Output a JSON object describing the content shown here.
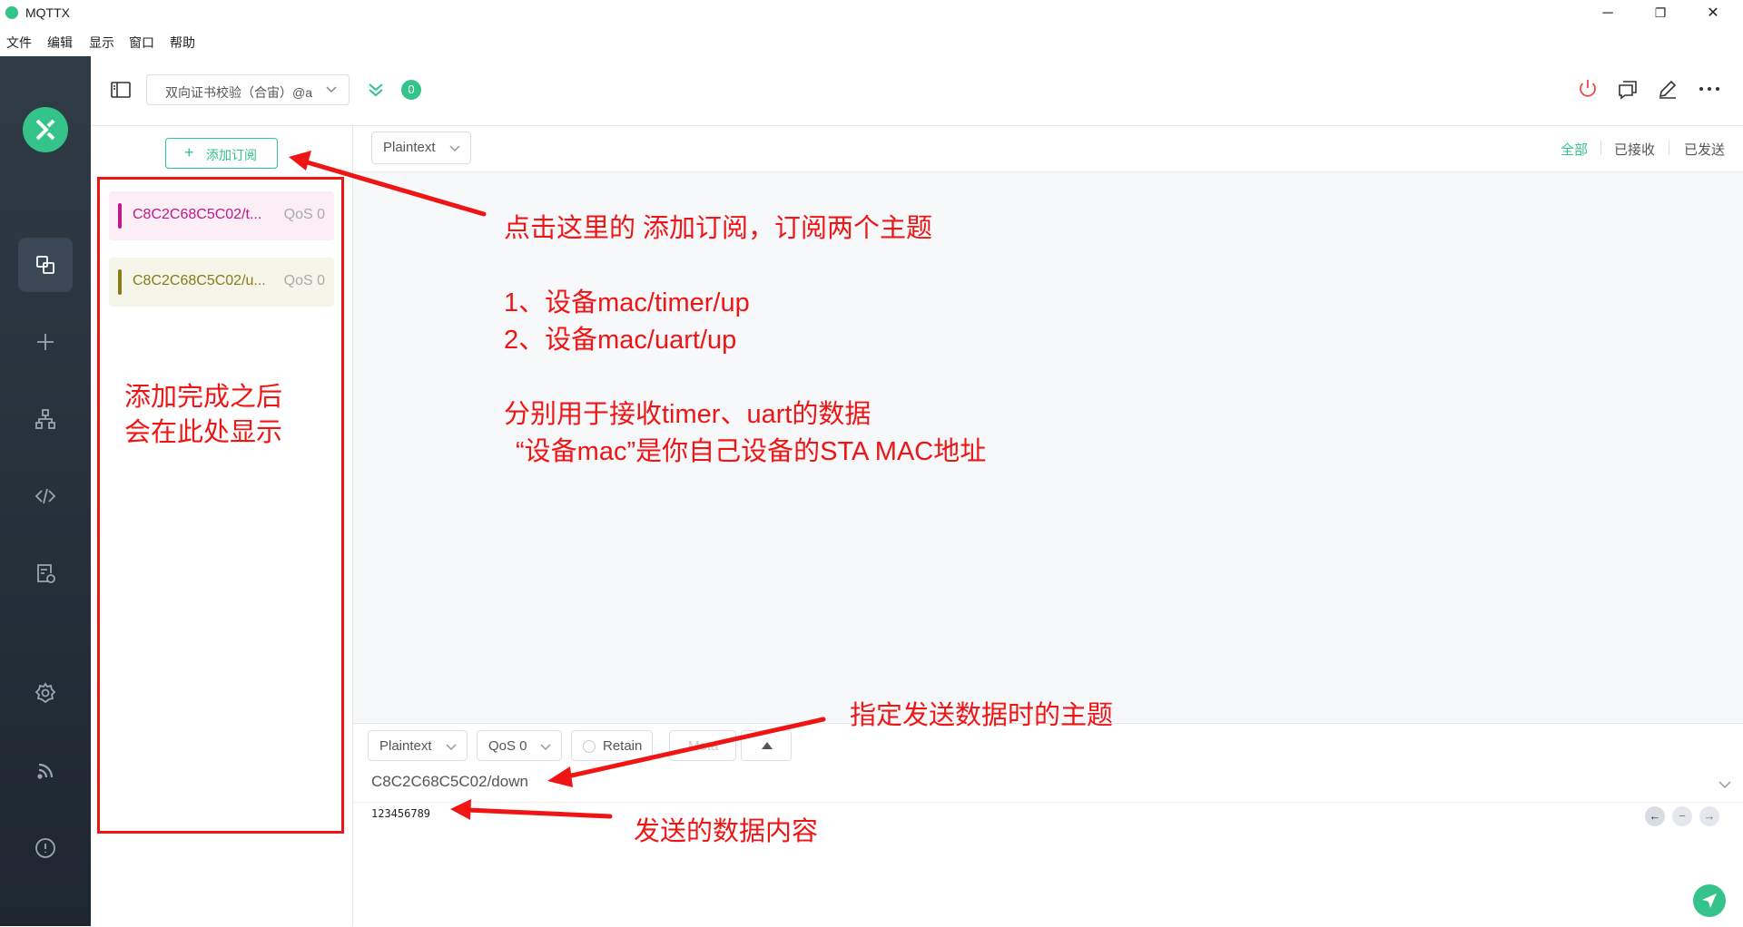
{
  "window": {
    "title": "MQTTX",
    "minimize": "─",
    "restore": "❐",
    "close": "✕"
  },
  "menu": [
    "文件",
    "编辑",
    "显示",
    "窗口",
    "帮助"
  ],
  "connection": {
    "name": "双向证书校验（合宙）@a",
    "message_count": "0"
  },
  "subscriptions": {
    "add_label": "添加订阅",
    "items": [
      {
        "topic": "C8C2C68C5C02/t...",
        "qos": "QoS 0",
        "color": "#c1188a",
        "bg": "#fbeef6"
      },
      {
        "topic": "C8C2C68C5C02/u...",
        "qos": "QoS 0",
        "color": "#8a7a18",
        "bg": "#f6f5ea"
      }
    ]
  },
  "messages": {
    "format": "Plaintext",
    "filters": {
      "all": "全部",
      "received": "已接收",
      "sent": "已发送"
    }
  },
  "publish": {
    "format": "Plaintext",
    "qos": "QoS 0",
    "retain": "Retain",
    "meta": "Meta",
    "topic": "C8C2C68C5C02/down",
    "payload": "123456789"
  },
  "annotations": {
    "add_sub": "点击这里的 添加订阅，订阅两个主题",
    "topic1": "1、设备mac/timer/up",
    "topic2": "2、设备mac/uart/up",
    "purpose": "分别用于接收timer、uart的数据",
    "mac_note": "“设备mac”是你自己设备的STA MAC地址",
    "list_note_1": "添加完成之后",
    "list_note_2": "会在此处显示",
    "pub_topic": "指定发送数据时的主题",
    "pub_payload": "发送的数据内容"
  },
  "colors": {
    "accent": "#34c388",
    "annotation": "#f01515",
    "sidebar": "#2a3540"
  }
}
